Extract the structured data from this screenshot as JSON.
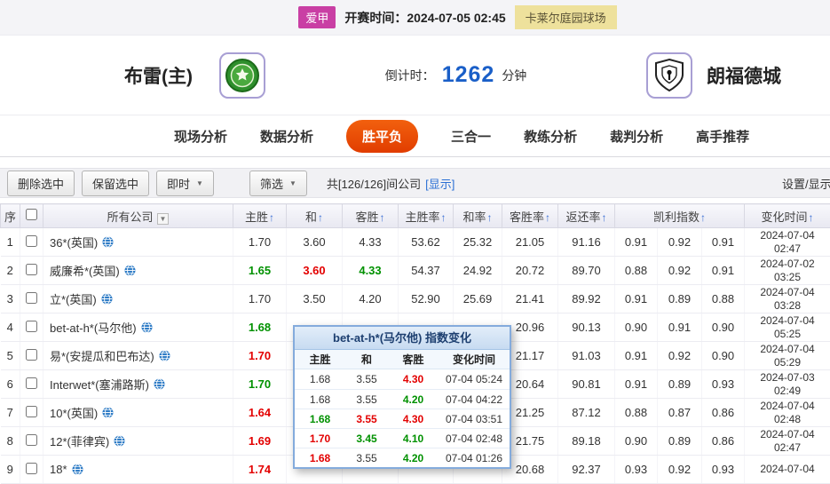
{
  "icons": {
    "sort_asc": "↑",
    "caret_down": "▼"
  },
  "top_bar": {
    "league": "爱甲",
    "kickoff": "开赛时间：2024-07-05 02:45",
    "venue": "卡莱尔庭园球场"
  },
  "match": {
    "home_team": "布雷(主)",
    "away_team": "朗福德城",
    "countdown_label": "倒计时：",
    "countdown_value": "1262",
    "countdown_unit": "分钟"
  },
  "nav": {
    "tabs": [
      {
        "label": "现场分析",
        "active": false
      },
      {
        "label": "数据分析",
        "active": false
      },
      {
        "label": "胜平负",
        "active": true
      },
      {
        "label": "三合一",
        "active": false
      },
      {
        "label": "教练分析",
        "active": false
      },
      {
        "label": "裁判分析",
        "active": false
      },
      {
        "label": "高手推荐",
        "active": false
      }
    ]
  },
  "toolbar": {
    "delete_selected": "删除选中",
    "keep_selected": "保留选中",
    "instant": "即时",
    "filter": "筛选",
    "count_text": "共[126/126]间公司",
    "show_link": "[显示]",
    "settings": "设置/显示"
  },
  "table": {
    "headers": {
      "index": "序",
      "company": "所有公司",
      "home": "主胜",
      "draw": "和",
      "away": "客胜",
      "home_rate": "主胜率",
      "draw_rate": "和率",
      "away_rate": "客胜率",
      "return_rate": "返还率",
      "kelly": "凯利指数",
      "change_time": "变化时间"
    },
    "rows": [
      {
        "no": "1",
        "company": "36*(英国)",
        "home": "1.70",
        "home_t": "",
        "draw": "3.60",
        "draw_t": "",
        "away": "4.33",
        "away_t": "",
        "home_rate": "53.62",
        "draw_rate": "25.32",
        "away_rate": "21.05",
        "return_rate": "91.16",
        "kelly": [
          "0.91",
          "0.92",
          "0.91"
        ],
        "date": "2024-07-04",
        "time": "02:47"
      },
      {
        "no": "2",
        "company": "威廉希*(英国)",
        "home": "1.65",
        "home_t": "down",
        "draw": "3.60",
        "draw_t": "up",
        "away": "4.33",
        "away_t": "down",
        "home_rate": "54.37",
        "draw_rate": "24.92",
        "away_rate": "20.72",
        "return_rate": "89.70",
        "kelly": [
          "0.88",
          "0.92",
          "0.91"
        ],
        "date": "2024-07-02",
        "time": "03:25"
      },
      {
        "no": "3",
        "company": "立*(英国)",
        "home": "1.70",
        "home_t": "",
        "draw": "3.50",
        "draw_t": "",
        "away": "4.20",
        "away_t": "",
        "home_rate": "52.90",
        "draw_rate": "25.69",
        "away_rate": "21.41",
        "return_rate": "89.92",
        "kelly": [
          "0.91",
          "0.89",
          "0.88"
        ],
        "date": "2024-07-04",
        "time": "03:28"
      },
      {
        "no": "4",
        "company": "bet-at-h*(马尔他)",
        "home": "1.68",
        "home_t": "down",
        "draw": "",
        "draw_t": "",
        "away": "",
        "away_t": "",
        "home_rate": "",
        "draw_rate": "",
        "away_rate": "20.96",
        "return_rate": "90.13",
        "kelly": [
          "0.90",
          "0.91",
          "0.90"
        ],
        "date": "2024-07-04",
        "time": "05:25"
      },
      {
        "no": "5",
        "company": "易*(安提瓜和巴布达)",
        "home": "1.70",
        "home_t": "up",
        "draw": "",
        "draw_t": "",
        "away": "",
        "away_t": "",
        "home_rate": "",
        "draw_rate": "",
        "away_rate": "21.17",
        "return_rate": "91.03",
        "kelly": [
          "0.91",
          "0.92",
          "0.90"
        ],
        "date": "2024-07-04",
        "time": "05:29"
      },
      {
        "no": "6",
        "company": "Interwet*(塞浦路斯)",
        "home": "1.70",
        "home_t": "down",
        "draw": "",
        "draw_t": "",
        "away": "",
        "away_t": "",
        "home_rate": "",
        "draw_rate": "",
        "away_rate": "20.64",
        "return_rate": "90.81",
        "kelly": [
          "0.91",
          "0.89",
          "0.93"
        ],
        "date": "2024-07-03",
        "time": "02:49"
      },
      {
        "no": "7",
        "company": "10*(英国)",
        "home": "1.64",
        "home_t": "up",
        "draw": "",
        "draw_t": "",
        "away": "",
        "away_t": "",
        "home_rate": "",
        "draw_rate": "",
        "away_rate": "21.25",
        "return_rate": "87.12",
        "kelly": [
          "0.88",
          "0.87",
          "0.86"
        ],
        "date": "2024-07-04",
        "time": "02:48"
      },
      {
        "no": "8",
        "company": "12*(菲律宾)",
        "home": "1.69",
        "home_t": "up",
        "draw": "",
        "draw_t": "",
        "away": "",
        "away_t": "",
        "home_rate": "",
        "draw_rate": "",
        "away_rate": "21.75",
        "return_rate": "89.18",
        "kelly": [
          "0.90",
          "0.89",
          "0.86"
        ],
        "date": "2024-07-04",
        "time": "02:47"
      },
      {
        "no": "9",
        "company": "18*",
        "home": "1.74",
        "home_t": "up",
        "draw": "",
        "draw_t": "",
        "away": "",
        "away_t": "",
        "home_rate": "",
        "draw_rate": "",
        "away_rate": "20.68",
        "return_rate": "92.37",
        "kelly": [
          "0.93",
          "0.92",
          "0.93"
        ],
        "date": "2024-07-04",
        "time": ""
      }
    ]
  },
  "popup": {
    "title": "bet-at-h*(马尔他) 指数变化",
    "headers": {
      "home": "主胜",
      "draw": "和",
      "away": "客胜",
      "time": "变化时间"
    },
    "rows": [
      {
        "home": "1.68",
        "home_t": "",
        "draw": "3.55",
        "draw_t": "",
        "away": "4.30",
        "away_t": "up",
        "time": "07-04 05:24"
      },
      {
        "home": "1.68",
        "home_t": "",
        "draw": "3.55",
        "draw_t": "",
        "away": "4.20",
        "away_t": "down",
        "time": "07-04 04:22"
      },
      {
        "home": "1.68",
        "home_t": "down",
        "draw": "3.55",
        "draw_t": "up",
        "away": "4.30",
        "away_t": "up",
        "time": "07-04 03:51"
      },
      {
        "home": "1.70",
        "home_t": "up",
        "draw": "3.45",
        "draw_t": "down",
        "away": "4.10",
        "away_t": "down",
        "time": "07-04 02:48"
      },
      {
        "home": "1.68",
        "home_t": "up",
        "draw": "3.55",
        "draw_t": "",
        "away": "4.20",
        "away_t": "down",
        "time": "07-04 01:26"
      }
    ]
  }
}
